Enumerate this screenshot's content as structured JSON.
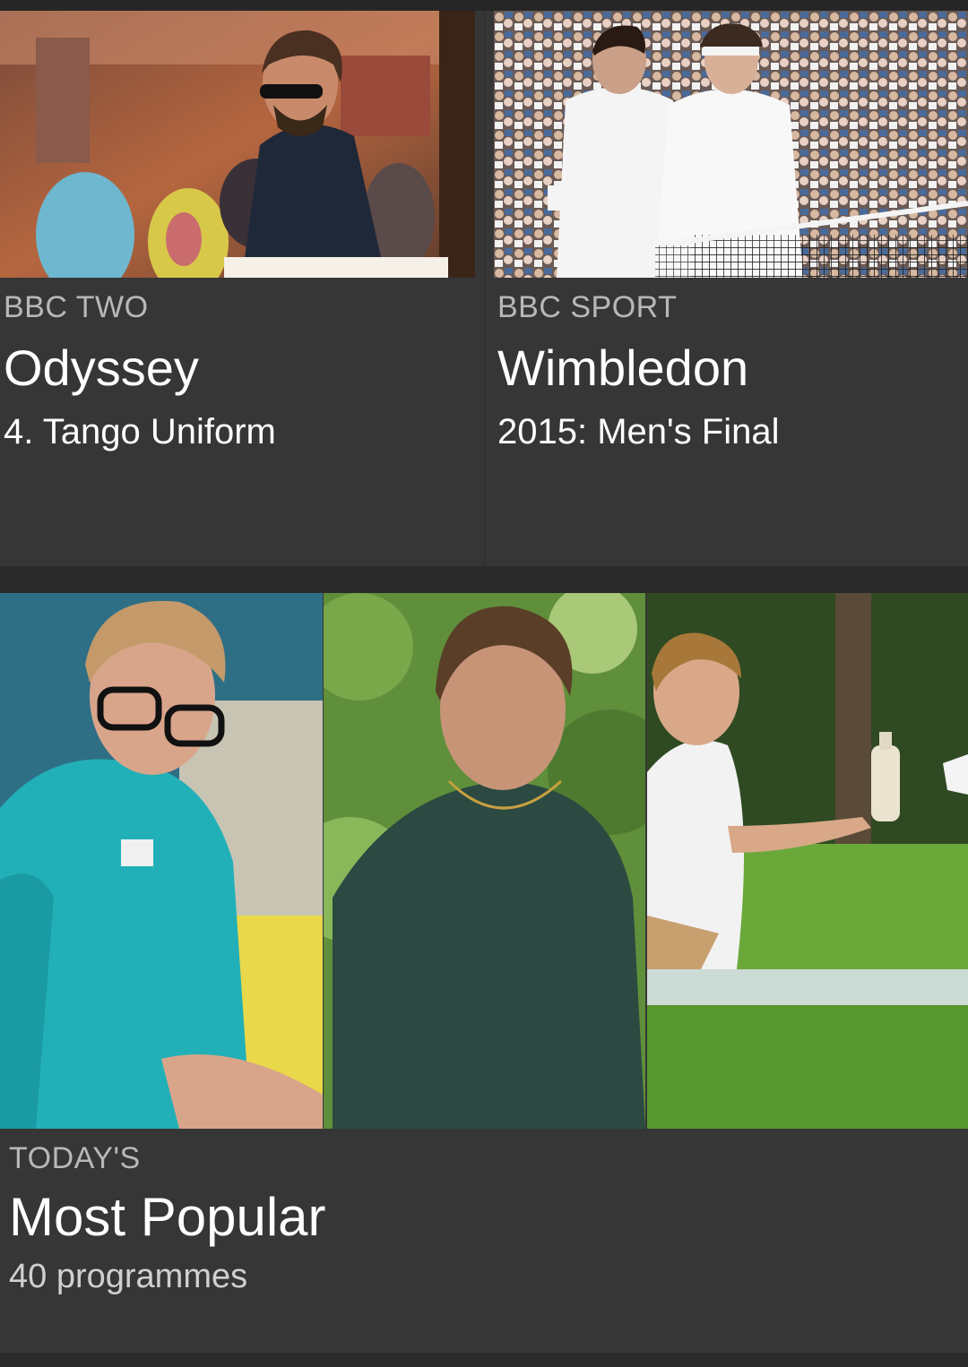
{
  "cards": [
    {
      "channel": "BBC TWO",
      "title": "Odyssey",
      "subtitle": "4. Tango Uniform",
      "image_icon": "photo-man-sunglasses-market"
    },
    {
      "channel": "BBC SPORT",
      "title": "Wimbledon",
      "subtitle": "2015: Men's Final",
      "image_icon": "photo-tennis-players-net"
    }
  ],
  "collection": {
    "eyebrow": "TODAY'S",
    "title": "Most Popular",
    "count_label": "40 programmes",
    "images": [
      "photo-doctor-scrubs",
      "photo-man-green-sweater",
      "photo-boy-picnic-grass"
    ]
  },
  "colors": {
    "background": "#2a2a2a",
    "card": "#363636",
    "eyebrow": "#b8b8b8",
    "title": "#ffffff"
  }
}
